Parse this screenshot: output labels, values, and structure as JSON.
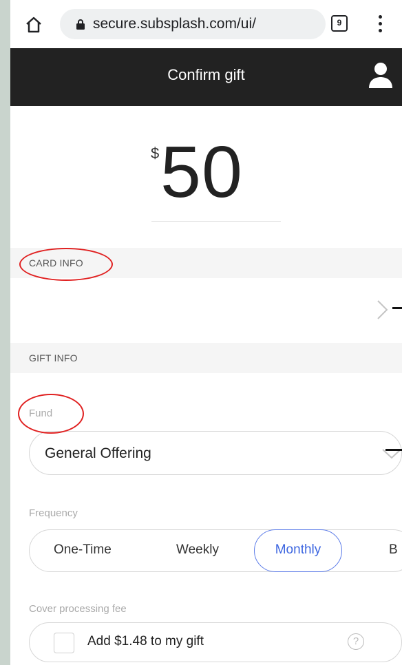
{
  "browser": {
    "url": "secure.subsplash.com/ui/",
    "tab_count": "9"
  },
  "header": {
    "title": "Confirm gift"
  },
  "gift": {
    "currency": "$",
    "amount": "50"
  },
  "sections": {
    "card_info": "CARD INFO",
    "gift_info": "GIFT INFO"
  },
  "fund": {
    "label": "Fund",
    "selected": "General Offering"
  },
  "frequency": {
    "label": "Frequency",
    "options": [
      "One-Time",
      "Weekly",
      "Monthly",
      "B"
    ],
    "selected": "Monthly"
  },
  "fee": {
    "label": "Cover processing fee",
    "checkbox_label": "Add $1.48 to my gift",
    "help": "?"
  },
  "colors": {
    "accent": "#3d66e0",
    "header_bg": "#222222",
    "annotation": "#e02020"
  }
}
